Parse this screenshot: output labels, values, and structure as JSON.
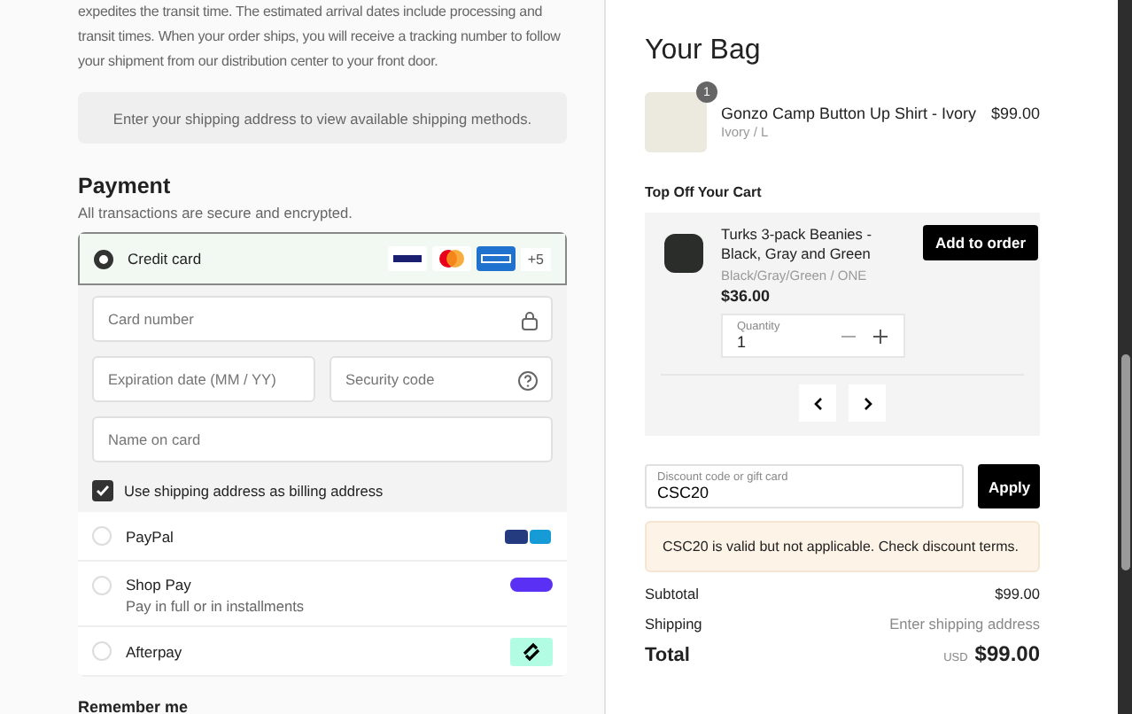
{
  "shipping_info": {
    "text": "expedites the transit time. The estimated arrival dates include processing and transit times. When your order ships, you will receive a tracking number to follow your shipment from our distribution center to your front door.",
    "notice": "Enter your shipping address to view available shipping methods."
  },
  "payment": {
    "title": "Payment",
    "subtitle": "All transactions are secure and encrypted.",
    "methods": [
      {
        "kind": "card",
        "label": "Credit card",
        "selected": true,
        "more": "+5",
        "fields": [
          {
            "placeholder": "Card number"
          },
          {
            "placeholder": "Expiration date (MM / YY)"
          },
          {
            "placeholder": "Security code"
          },
          {
            "placeholder": "Name on card"
          }
        ],
        "billing": {
          "label": "Use shipping address as billing address",
          "checked": true
        }
      },
      {
        "kind": "paypal",
        "label": "PayPal",
        "selected": false
      },
      {
        "kind": "shoppay",
        "label": "Shop Pay",
        "sublabel": "Pay in full or in installments",
        "selected": false
      },
      {
        "kind": "afterpay",
        "label": "Afterpay",
        "selected": false
      }
    ]
  },
  "remember": {
    "title": "Remember me"
  },
  "bag": {
    "title": "Your Bag",
    "items": [
      {
        "name": "Gonzo Camp Button Up Shirt - Ivory",
        "variant": "Ivory / L",
        "price": "$99.00",
        "quantity": "1"
      }
    ]
  },
  "upsell": {
    "title": "Top Off Your Cart",
    "product": {
      "name": "Turks 3-pack Beanies - Black, Gray and Green",
      "variant": "Black/Gray/Green / ONE",
      "price": "$36.00",
      "button": "Add to order",
      "quantity_label": "Quantity",
      "quantity": "1"
    }
  },
  "discount": {
    "label": "Discount code or gift card",
    "value": "CSC20",
    "button": "Apply",
    "message": "CSC20 is valid but not applicable. Check discount terms."
  },
  "summary": [
    {
      "label": "Subtotal",
      "value": "$99.00",
      "kind": "plain"
    },
    {
      "label": "Shipping",
      "value": "Enter shipping address",
      "kind": "muted"
    }
  ],
  "total": {
    "label": "Total",
    "currency": "USD",
    "value": "$99.00"
  }
}
